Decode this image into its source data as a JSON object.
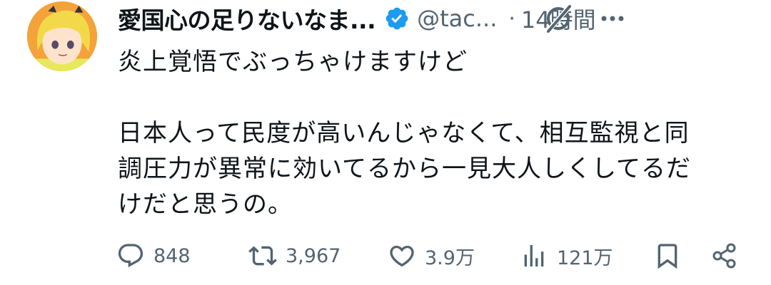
{
  "tweet": {
    "display_name": "愛国心の足りないなま...",
    "handle": "@tac...",
    "separator": "·",
    "time": "14時間",
    "lines": [
      "炎上覚悟でぶっちゃけますけど",
      "",
      "日本人って民度が高いんじゃなくて、相互監視と同",
      "調圧力が異常に効いてるから一見大人しくしてるだ",
      "けだと思うの。"
    ]
  },
  "actions": {
    "replies": "848",
    "reposts": "3,967",
    "likes": "3.9万",
    "views": "121万"
  },
  "colors": {
    "text": "#0f1419",
    "secondary": "#536471",
    "verified": "#1d9bf0",
    "avatar_bg": "#f4a23a"
  },
  "icons": [
    "verified-badge-icon",
    "grok-icon",
    "more-icon",
    "reply-icon",
    "repost-icon",
    "like-icon",
    "views-icon",
    "bookmark-icon",
    "share-icon"
  ]
}
